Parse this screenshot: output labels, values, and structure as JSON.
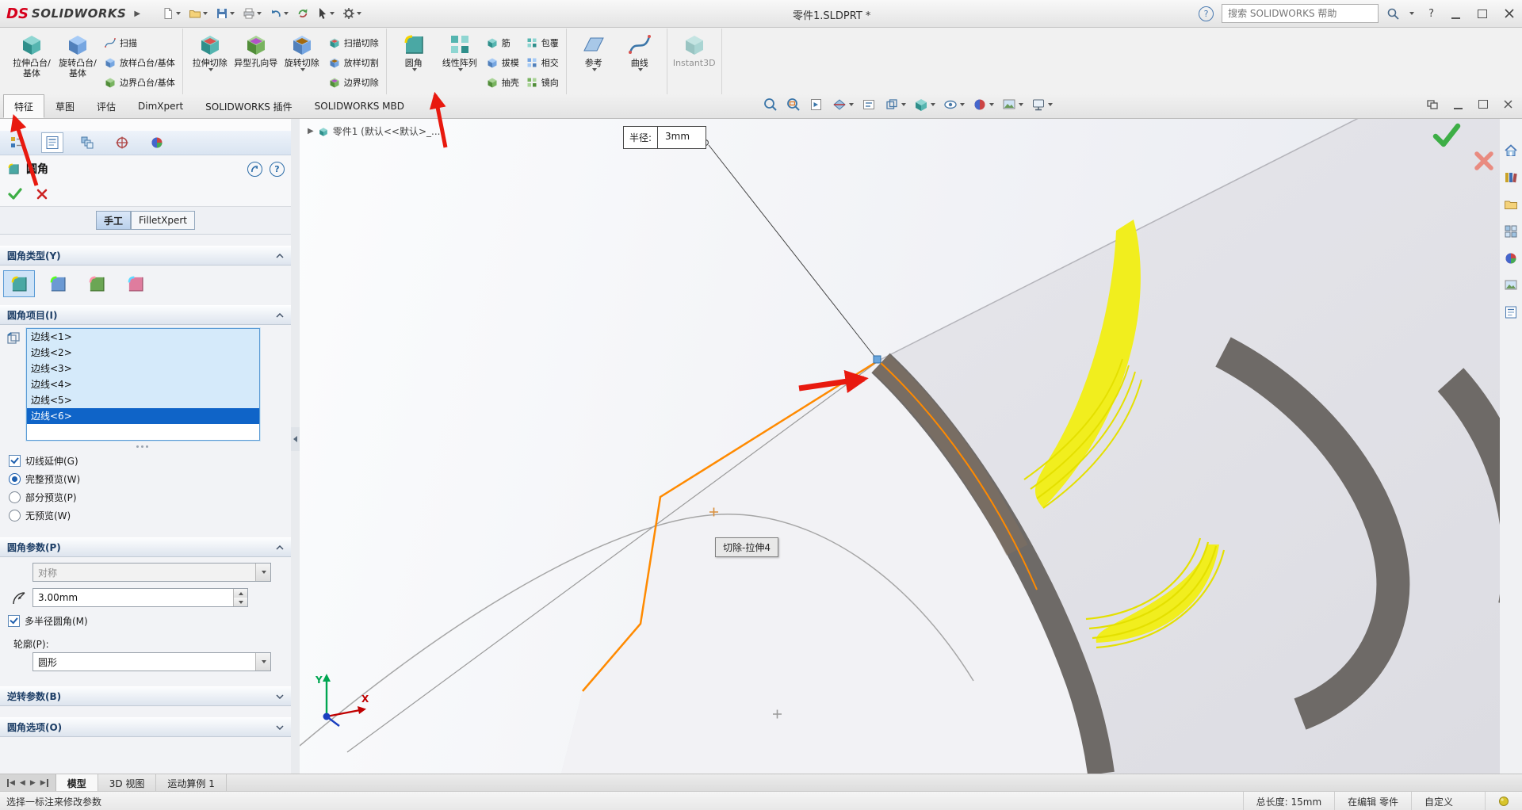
{
  "titlebar": {
    "brand": "SOLIDWORKS",
    "doc_title": "零件1.SLDPRT *",
    "search_placeholder": "搜索 SOLIDWORKS 帮助"
  },
  "ribbon": {
    "groups": [
      {
        "big": [
          "拉伸凸台/基体",
          "旋转凸台/基体"
        ],
        "small": [
          "扫描",
          "放样凸台/基体",
          "边界凸台/基体"
        ]
      },
      {
        "big": [
          "拉伸切除",
          "异型孔向导",
          "旋转切除"
        ],
        "small": [
          "扫描切除",
          "放样切割",
          "边界切除"
        ]
      },
      {
        "big": [
          "圆角",
          "线性阵列"
        ],
        "small": [
          "筋",
          "拔模",
          "抽壳",
          "包覆",
          "相交",
          "镜向"
        ]
      },
      {
        "big": [
          "参考",
          "曲线"
        ],
        "small": []
      },
      {
        "big": [
          "Instant3D"
        ],
        "small": []
      }
    ]
  },
  "command_tabs": {
    "items": [
      "特征",
      "草图",
      "评估",
      "DimXpert",
      "SOLIDWORKS 插件",
      "SOLIDWORKS MBD"
    ],
    "active": "特征"
  },
  "feature_tree": {
    "breadcrumb": "零件1 (默认<<默认>_..."
  },
  "property_manager": {
    "title": "圆角",
    "mode_manual": "手工",
    "mode_expert": "FilletXpert",
    "sec_type": "圆角类型(Y)",
    "sec_items": "圆角项目(I)",
    "sec_params": "圆角参数(P)",
    "sec_setback": "逆转参数(B)",
    "sec_options": "圆角选项(O)",
    "edges": [
      "边线<1>",
      "边线<2>",
      "边线<3>",
      "边线<4>",
      "边线<5>",
      "边线<6>"
    ],
    "selected_edge_index": 5,
    "chk_tangent": "切线延伸(G)",
    "radio_full": "完整预览(W)",
    "radio_partial": "部分预览(P)",
    "radio_none": "无预览(W)",
    "combo_symmetric": "对称",
    "radius_value": "3.00mm",
    "chk_multi_radius": "多半径圆角(M)",
    "profile_label": "轮廓(P):",
    "combo_profile": "圆形"
  },
  "viewport": {
    "callout_label": "半径:",
    "callout_value": "3mm",
    "tooltip": "切除-拉伸4",
    "axis_x": "X",
    "axis_y": "Y"
  },
  "bottom_tabs": {
    "items": [
      "模型",
      "3D 视图",
      "运动算例 1"
    ],
    "active": "模型"
  },
  "statusbar": {
    "message": "选择一标注来修改参数",
    "total_length": "总长度: 15mm",
    "edit_state": "在编辑 零件",
    "custom": "自定义"
  },
  "colors": {
    "selection_blue": "#0f64c8",
    "edge_orange": "#ff8a00",
    "preview_yellow": "#f1ee1e",
    "annotation_red": "#e8190f",
    "confirm_green": "#3dae46",
    "cancel_red": "#e98b80"
  }
}
